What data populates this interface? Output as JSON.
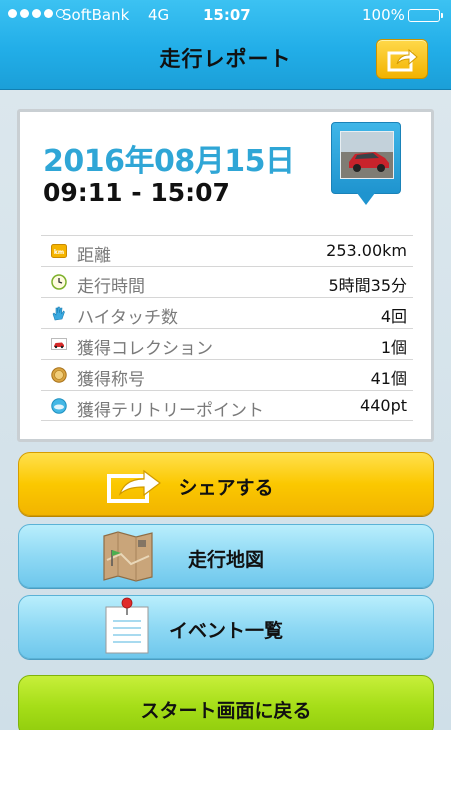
{
  "status_bar": {
    "carrier": "SoftBank",
    "network": "4G",
    "time": "15:07",
    "battery": "100%",
    "signal_bars": 4
  },
  "nav": {
    "title": "走行レポート",
    "share_icon": "share-icon"
  },
  "report": {
    "date": "2016年08月15日",
    "time_range": "09:11 - 15:07",
    "stats": [
      {
        "icon": "km-icon",
        "label": "距離",
        "value": "253.00km"
      },
      {
        "icon": "clock-icon",
        "label": "走行時間",
        "value": "5時間35分"
      },
      {
        "icon": "hand-icon",
        "label": "ハイタッチ数",
        "value": "4回"
      },
      {
        "icon": "car-icon",
        "label": "獲得コレクション",
        "value": "1個"
      },
      {
        "icon": "medal-icon",
        "label": "獲得称号",
        "value": "41個"
      },
      {
        "icon": "spot-icon",
        "label": "獲得テリトリーポイント",
        "value": "440pt"
      }
    ]
  },
  "buttons": {
    "share": "シェアする",
    "map": "走行地図",
    "events": "イベント一覧",
    "start": "スタート画面に戻る"
  },
  "colors": {
    "header": "#22aee8",
    "date_text": "#2fa6d6",
    "share_button": "#fbc800",
    "blue_button": "#8fd9f4",
    "green_button": "#a6de18"
  }
}
